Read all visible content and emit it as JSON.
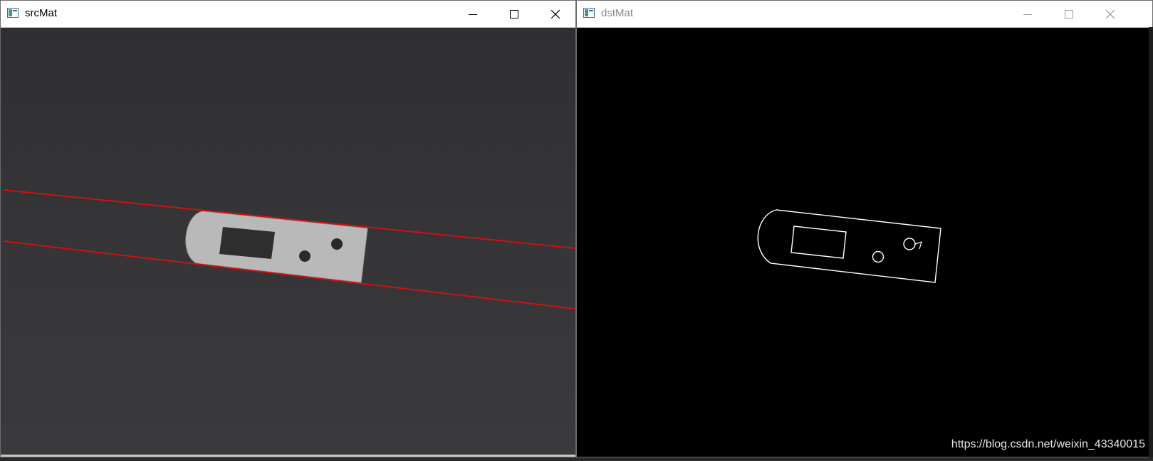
{
  "windows": {
    "src": {
      "title": "srcMat"
    },
    "dst": {
      "title": "dstMat"
    }
  },
  "controls": {
    "minimize_icon": "minimize-icon",
    "maximize_icon": "maximize-icon",
    "close_icon": "close-icon"
  },
  "colors": {
    "fitted_line": "#cc1111",
    "part_fill": "#b9b9b9",
    "hole_fill": "#2a2a2a",
    "edge_stroke": "#ffffff",
    "title_active": "#000000",
    "title_inactive": "#8a8a8a"
  },
  "watermark": "https://blog.csdn.net/weixin_43340015"
}
